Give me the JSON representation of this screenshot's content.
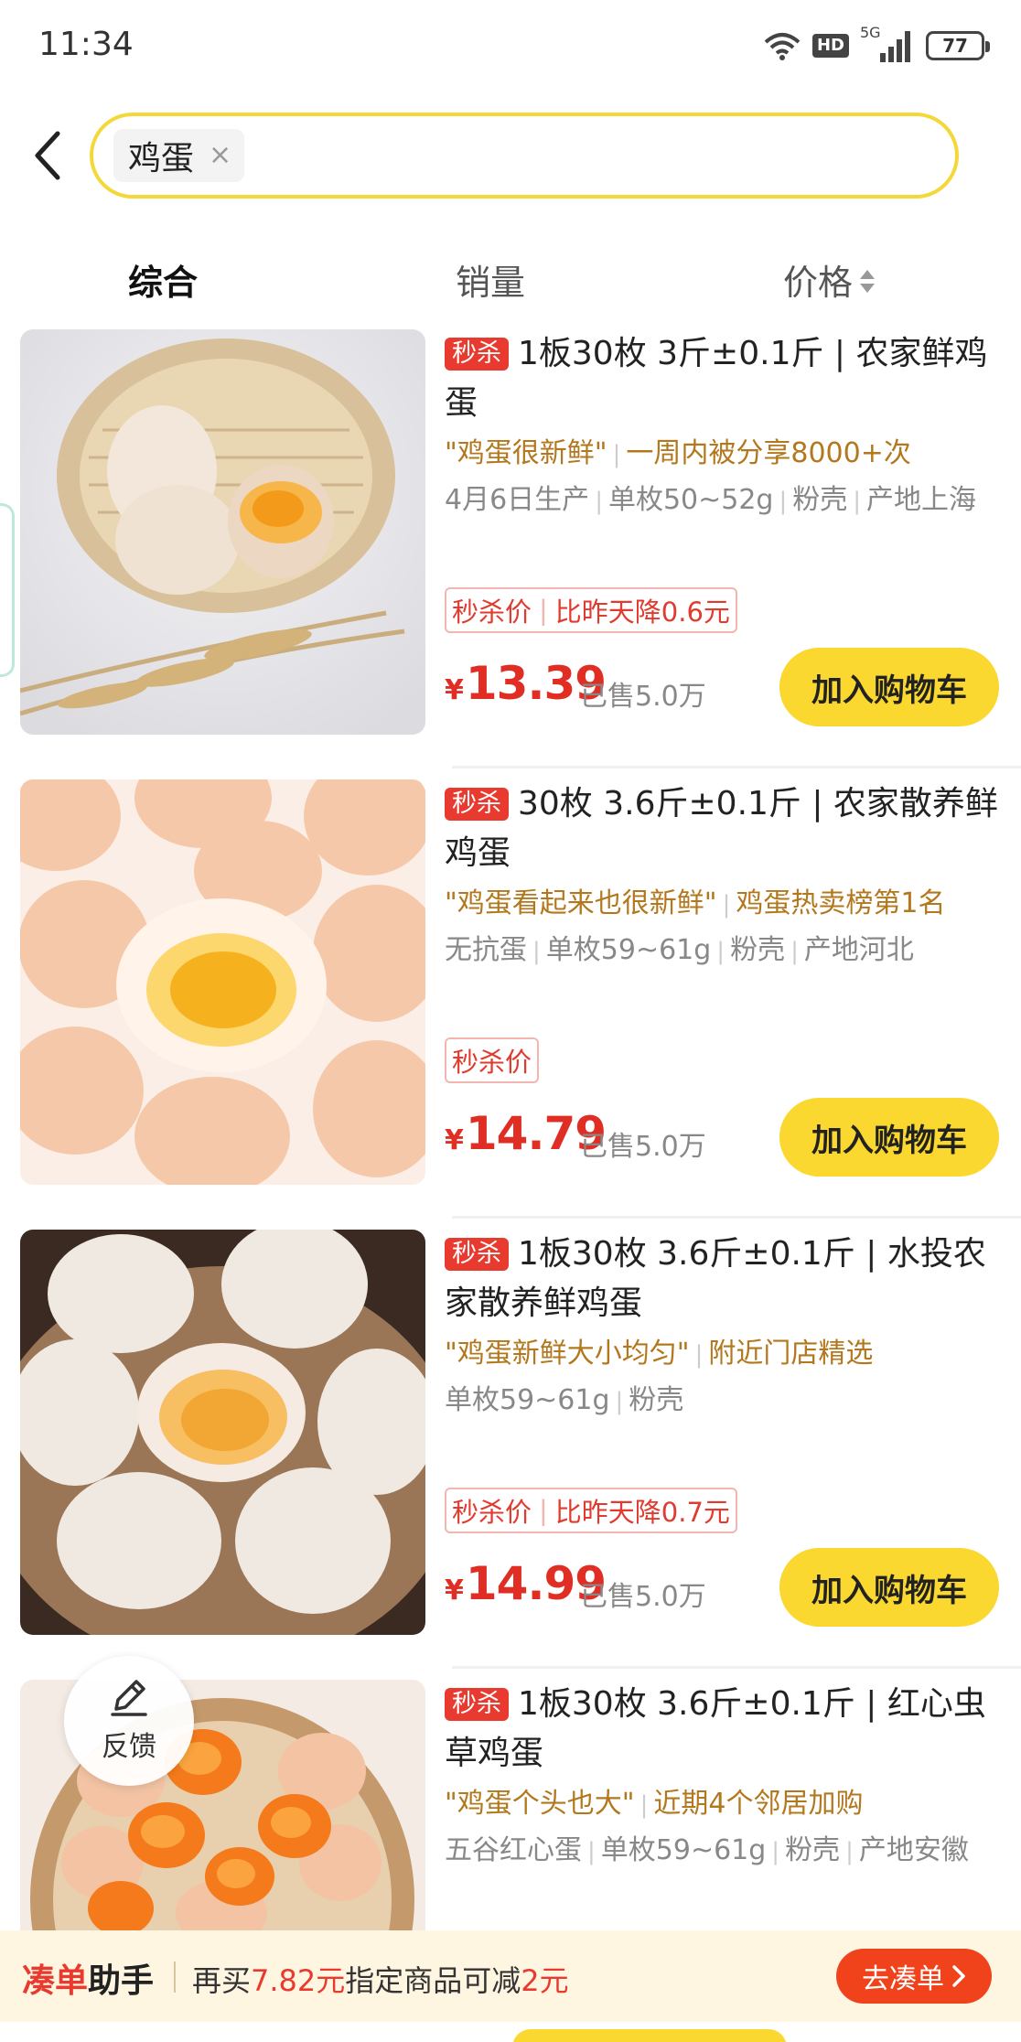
{
  "status_bar": {
    "time": "11:34",
    "network": "5G",
    "hd": "HD",
    "battery": "77"
  },
  "search": {
    "chip_text": "鸡蛋",
    "chip_close": "×"
  },
  "sort_tabs": [
    {
      "label": "综合"
    },
    {
      "label": "销量"
    },
    {
      "label": "价格"
    }
  ],
  "products": [
    {
      "tag": "秒杀",
      "title": "1板30枚 3斤±0.1斤 | 农家鲜鸡蛋",
      "review": "\"鸡蛋很新鲜\"",
      "highlight": "一周内被分享8000+次",
      "specs": [
        "4月6日生产",
        "单枚50~52g",
        "粉壳",
        "产地上海"
      ],
      "promo_label": "秒杀价",
      "promo_note": "比昨天降0.6元",
      "currency": "¥",
      "price": "13.39",
      "sold": "已售5.0万",
      "cart_label": "加入购物车"
    },
    {
      "tag": "秒杀",
      "title": "30枚 3.6斤±0.1斤 | 农家散养鲜鸡蛋",
      "review": "\"鸡蛋看起来也很新鲜\"",
      "highlight": "鸡蛋热卖榜第1名",
      "specs": [
        "无抗蛋",
        "单枚59~61g",
        "粉壳",
        "产地河北"
      ],
      "promo_label": "秒杀价",
      "promo_note": "",
      "currency": "¥",
      "price": "14.79",
      "sold": "已售5.0万",
      "cart_label": "加入购物车"
    },
    {
      "tag": "秒杀",
      "title": "1板30枚 3.6斤±0.1斤 | 水投农家散养鲜鸡蛋",
      "review": "\"鸡蛋新鲜大小均匀\"",
      "highlight": "附近门店精选",
      "specs": [
        "单枚59~61g",
        "粉壳"
      ],
      "promo_label": "秒杀价",
      "promo_note": "比昨天降0.7元",
      "currency": "¥",
      "price": "14.99",
      "sold": "已售5.0万",
      "cart_label": "加入购物车"
    },
    {
      "tag": "秒杀",
      "title": "1板30枚 3.6斤±0.1斤 | 红心虫草鸡蛋",
      "review": "\"鸡蛋个头也大\"",
      "highlight": "近期4个邻居加购",
      "specs": [
        "五谷红心蛋",
        "单枚59~61g",
        "粉壳",
        "产地安徽"
      ]
    }
  ],
  "feedback": {
    "label": "反馈"
  },
  "bottom_bar": {
    "title_a": "凑单",
    "title_b": "助手",
    "text_a": "再买",
    "amount": "7.82元",
    "text_b": "指定商品可减",
    "discount": "2元",
    "button": "去凑单"
  },
  "colors": {
    "accent_yellow": "#fbd82f",
    "price_red": "#e02e24",
    "review_brown": "#b3781d"
  }
}
